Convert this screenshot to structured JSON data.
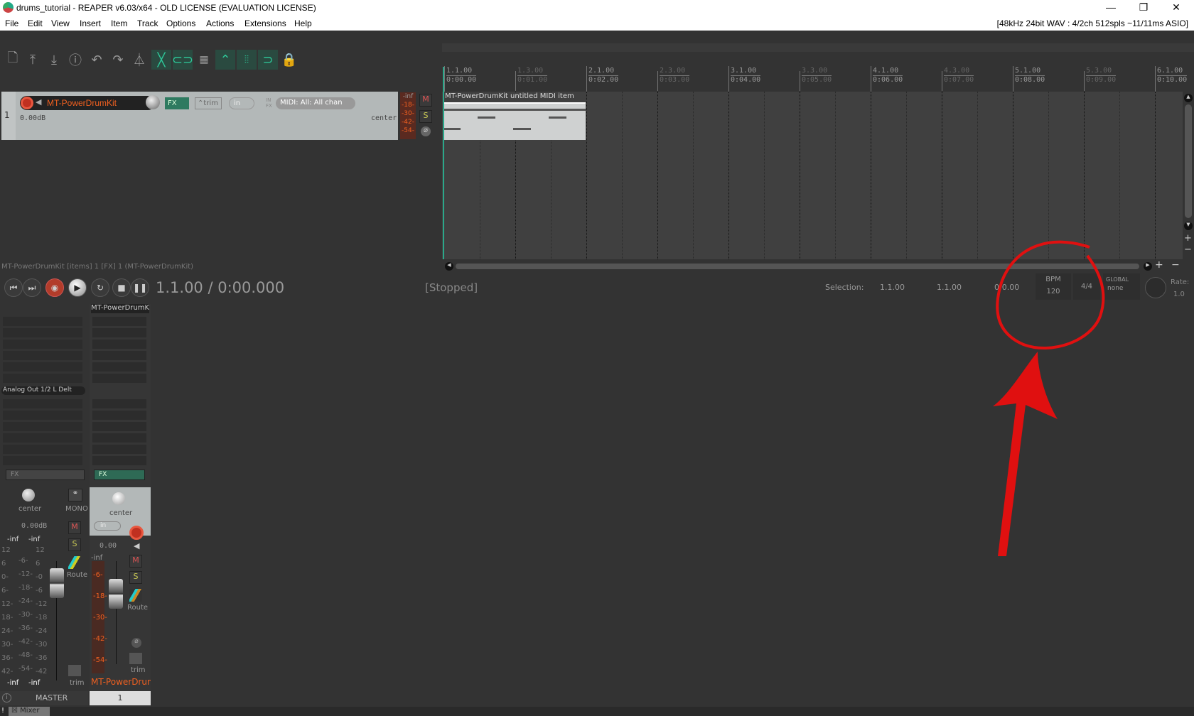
{
  "window": {
    "title": "drums_tutorial - REAPER v6.03/x64 - OLD LICENSE (EVALUATION LICENSE)",
    "minimize": "—",
    "restore": "❐",
    "close": "✕"
  },
  "menu": {
    "items": [
      "File",
      "Edit",
      "View",
      "Insert",
      "Item",
      "Track",
      "Options",
      "Actions",
      "Extensions",
      "Help"
    ],
    "audio_status": "[48kHz 24bit WAV : 4/2ch 512spls ~11/11ms ASIO]"
  },
  "toolbar": {
    "icons": [
      "new-project-icon",
      "open-project-icon",
      "save-project-icon",
      "project-info-icon",
      "undo-icon",
      "redo-icon",
      "metronome-icon",
      "auto-crossfade-icon",
      "lock-link-icon",
      "grid-icon",
      "envelope-link-icon",
      "snap-grid-icon",
      "loop-icon",
      "lock-icon"
    ]
  },
  "ruler": {
    "markers": [
      {
        "bar": "1.1.00",
        "time": "0:00.00",
        "major": true
      },
      {
        "bar": "1.3.00",
        "time": "0:01.00",
        "major": false
      },
      {
        "bar": "2.1.00",
        "time": "0:02.00",
        "major": true
      },
      {
        "bar": "2.3.00",
        "time": "0:03.00",
        "major": false
      },
      {
        "bar": "3.1.00",
        "time": "0:04.00",
        "major": true
      },
      {
        "bar": "3.3.00",
        "time": "0:05.00",
        "major": false
      },
      {
        "bar": "4.1.00",
        "time": "0:06.00",
        "major": true
      },
      {
        "bar": "4.3.00",
        "time": "0:07.00",
        "major": false
      },
      {
        "bar": "5.1.00",
        "time": "0:08.00",
        "major": true
      },
      {
        "bar": "5.3.00",
        "time": "0:09.00",
        "major": false
      },
      {
        "bar": "6.1.00",
        "time": "0:10.00",
        "major": true
      }
    ]
  },
  "track": {
    "number": "1",
    "name": "MT-PowerDrumKit",
    "volume": "0.00dB",
    "pan": "center",
    "fx": "FX",
    "trim": "trim",
    "input": "in",
    "midi_input": "MIDI: All: All chan",
    "in_fx": "IN FX",
    "meter": [
      "-inf",
      "-18-",
      "-30-",
      "-42-",
      "-54-"
    ],
    "mute": "M",
    "solo": "S"
  },
  "item": {
    "name": "MT-PowerDrumKit untitled MIDI item"
  },
  "status_line": "MT-PowerDrumKit [items] 1 [FX] 1 (MT-PowerDrumKit)",
  "transport": {
    "position": "1.1.00 / 0:00.000",
    "state": "[Stopped]",
    "selection_label": "Selection:",
    "sel_start": "1.1.00",
    "sel_end": "1.1.00",
    "sel_length": "0:0.00",
    "bpm_label": "BPM",
    "bpm": "120",
    "time_sig": "4/4",
    "global_label": "GLOBAL",
    "automation": "none",
    "rate_label": "Rate:",
    "rate": "1.0"
  },
  "mixer": {
    "master": {
      "output": "Analog Out 1/2 L Delt",
      "fx": "FX",
      "pan": "center",
      "mono": "MONO",
      "volume": "0.00dB",
      "peak_l": "-inf",
      "peak_r": "-inf",
      "mute": "M",
      "solo": "S",
      "route": "Route",
      "trim": "trim",
      "label": "MASTER",
      "scale_left": [
        "12",
        "6",
        "0-",
        "6-",
        "12-",
        "18-",
        "24-",
        "30-",
        "36-",
        "42-"
      ],
      "scale_mid": [
        "-6-",
        "-12-",
        "-18-",
        "-24-",
        "-30-",
        "-36-",
        "-42-",
        "-48-",
        "-54-"
      ],
      "scale_right": [
        "12",
        "6",
        "-0",
        "-6",
        "-12",
        "-18",
        "-24",
        "-30",
        "-36",
        "-42"
      ],
      "bottom_l": "-inf",
      "bottom_r": "-inf"
    },
    "track": {
      "name_top": "MT-PowerDrumKit",
      "fx": "FX",
      "pan": "center",
      "input": "in",
      "volume": "0.00",
      "peak": "-inf",
      "meter": [
        "-6-",
        "-18-",
        "-30-",
        "-42-",
        "-54-"
      ],
      "mute": "M",
      "solo": "S",
      "route": "Route",
      "trim": "trim",
      "name": "MT-PowerDrumKit",
      "number": "1"
    },
    "tab": "Mixer"
  },
  "annotation": {
    "color": "#e01010"
  }
}
